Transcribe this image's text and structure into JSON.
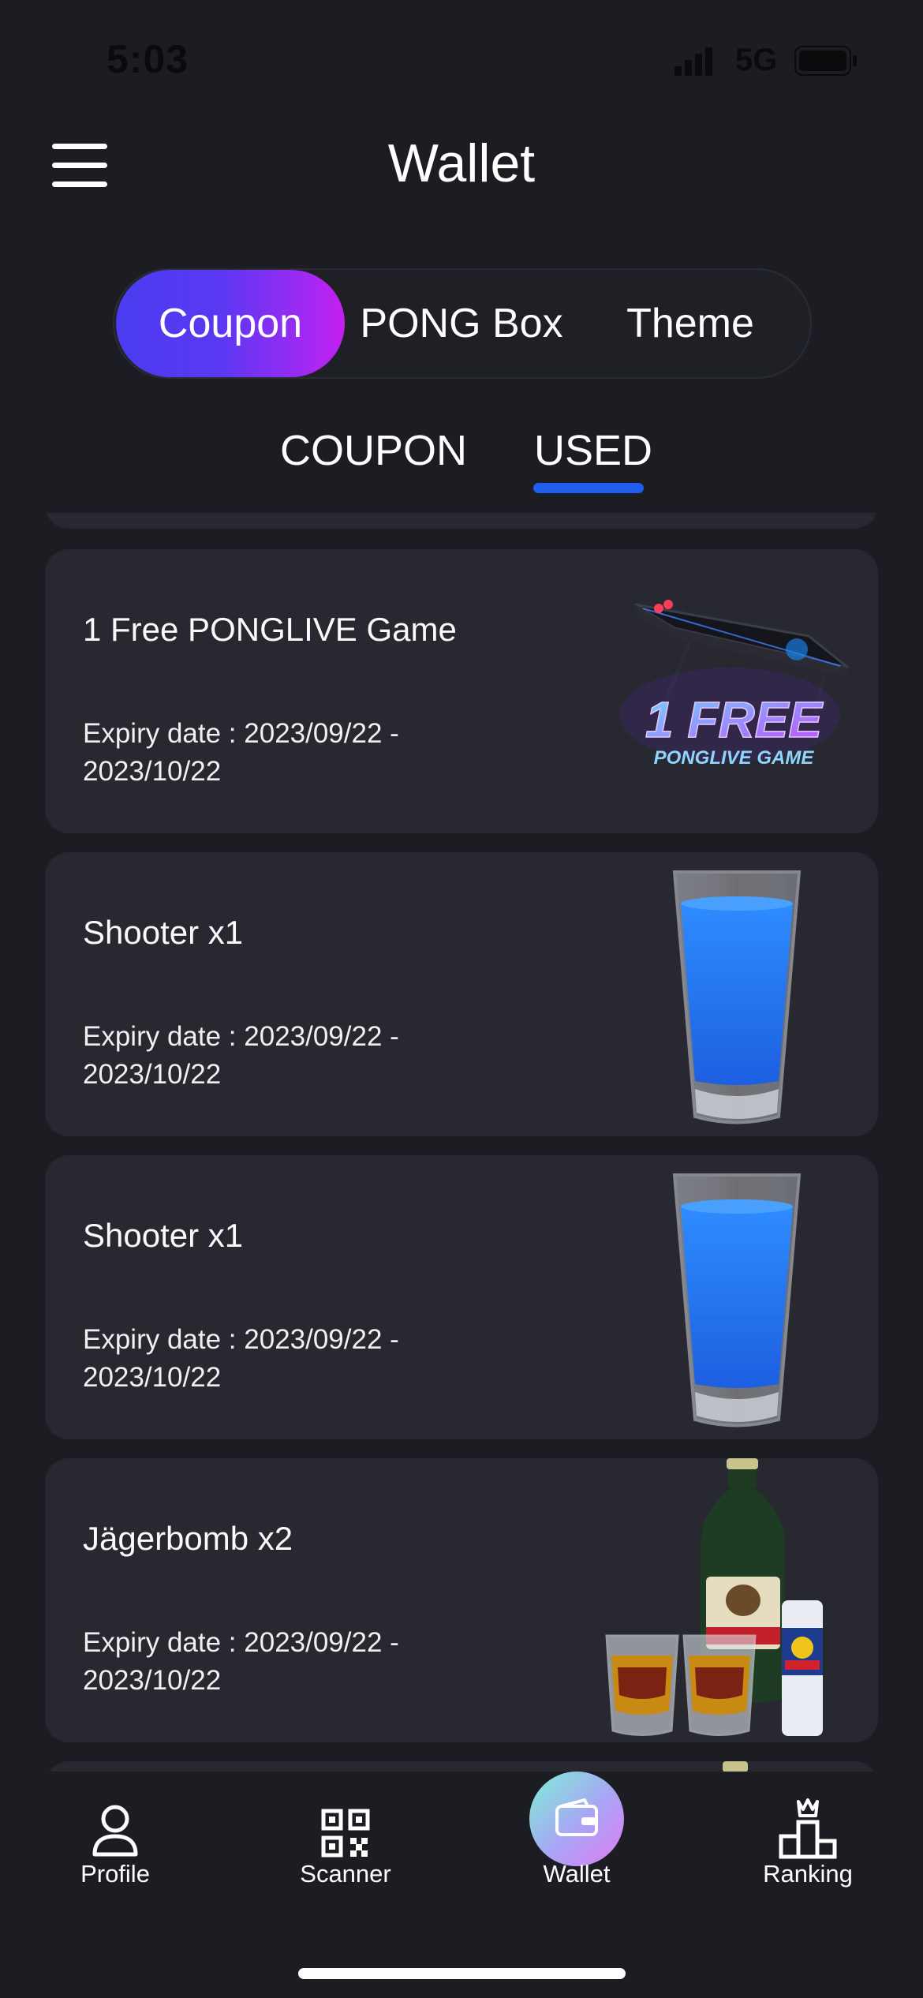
{
  "status_bar": {
    "time": "5:03",
    "network": "5G"
  },
  "header": {
    "title": "Wallet",
    "menu_icon": "hamburger-menu-icon"
  },
  "segment_tabs": [
    {
      "label": "Coupon",
      "active": true
    },
    {
      "label": "PONG Box",
      "active": false
    },
    {
      "label": "Theme",
      "active": false
    }
  ],
  "sub_tabs": [
    {
      "label": "COUPON",
      "active": false
    },
    {
      "label": "USED",
      "active": true
    }
  ],
  "coupons": [
    {
      "title": "1 Free PONGLIVE Game",
      "expiry": "Expiry date : 2023/09/22 - 2023/10/22",
      "image": "ponglive-table",
      "art_line1": "1 FREE",
      "art_line2": "PONGLIVE GAME"
    },
    {
      "title": "Shooter x1",
      "expiry": "Expiry date : 2023/09/22 - 2023/10/22",
      "image": "blue-shot-glass"
    },
    {
      "title": "Shooter x1",
      "expiry": "Expiry date : 2023/09/22 - 2023/10/22",
      "image": "blue-shot-glass"
    },
    {
      "title": "Jägerbomb x2",
      "expiry": "Expiry date : 2023/09/22 - 2023/10/22",
      "image": "jagerbomb-drinks"
    }
  ],
  "bottom_nav": [
    {
      "label": "Profile",
      "icon": "person-icon",
      "active": false
    },
    {
      "label": "Scanner",
      "icon": "qr-code-icon",
      "active": false
    },
    {
      "label": "Wallet",
      "icon": "wallet-icon",
      "active": true
    },
    {
      "label": "Ranking",
      "icon": "podium-icon",
      "active": false
    }
  ],
  "colors": {
    "background": "#1c1d22",
    "card": "#272830",
    "tab_gradient_start": "#4a3cf0",
    "tab_gradient_end": "#c51ff0",
    "underline": "#1f5cf0"
  }
}
